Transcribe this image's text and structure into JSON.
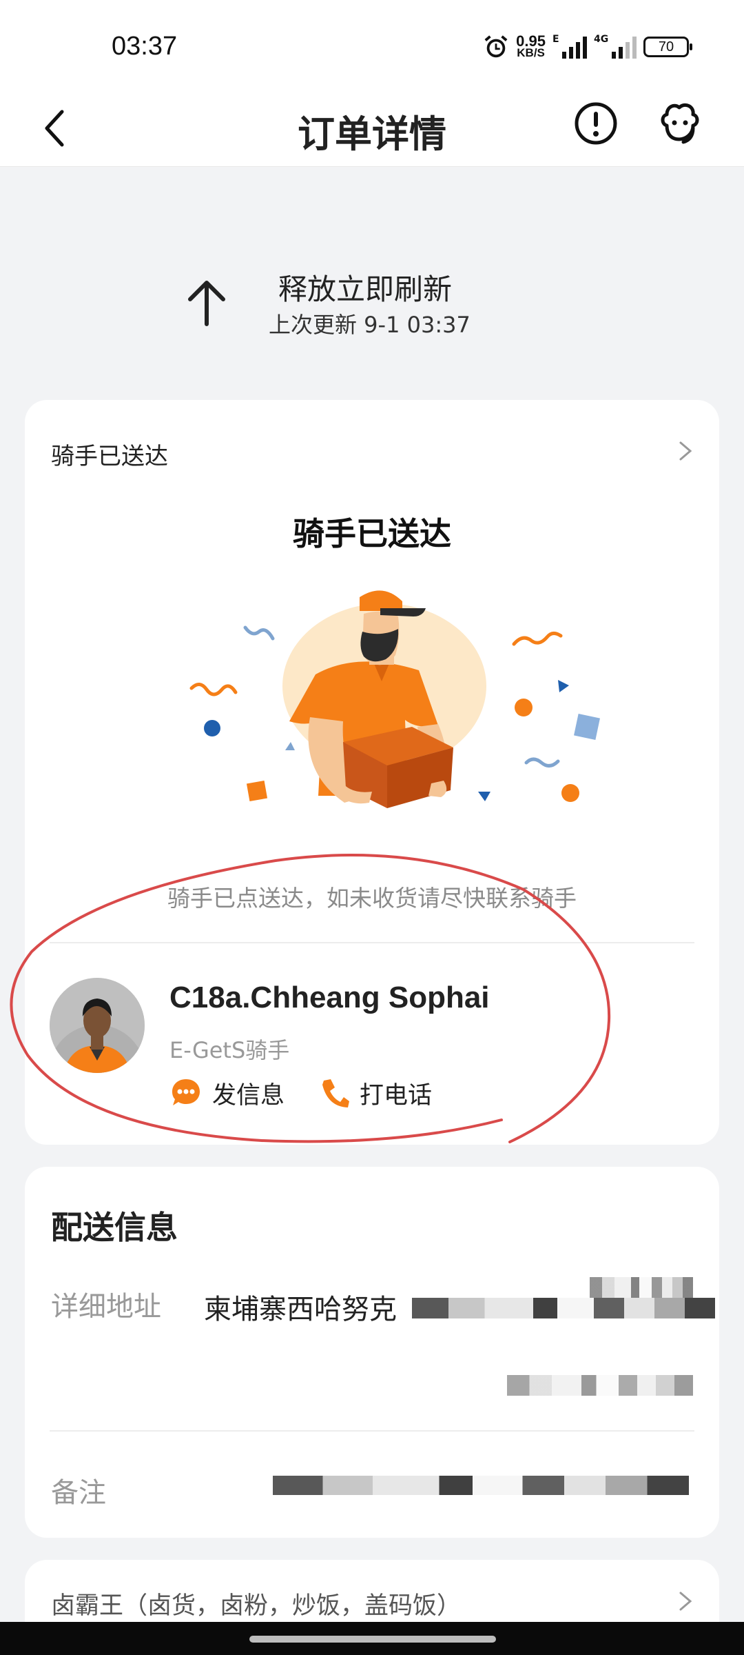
{
  "status_bar": {
    "time": "03:37",
    "net_speed_value": "0.95",
    "net_speed_unit": "KB/S",
    "signal1_label": "E",
    "signal2_label": "4G",
    "battery": "70"
  },
  "nav": {
    "title": "订单详情"
  },
  "refresh": {
    "title": "释放立即刷新",
    "subtitle": "上次更新 9-1 03:37"
  },
  "order_status": {
    "row_label": "骑手已送达",
    "headline": "骑手已送达",
    "hint": "骑手已点送达，如未收货请尽快联系骑手"
  },
  "rider": {
    "name": "C18a.Chheang Sophai",
    "role": "E-GetS骑手",
    "message_label": "发信息",
    "call_label": "打电话"
  },
  "delivery": {
    "title": "配送信息",
    "address_label": "详细地址",
    "address_value": "柬埔寨西哈努克",
    "remark_label": "备注"
  },
  "store": {
    "name": "卤霸王（卤货，卤粉，炒饭，盖码饭）"
  },
  "colors": {
    "accent_orange": "#f57f17",
    "annotation_red": "#d94a4a"
  }
}
